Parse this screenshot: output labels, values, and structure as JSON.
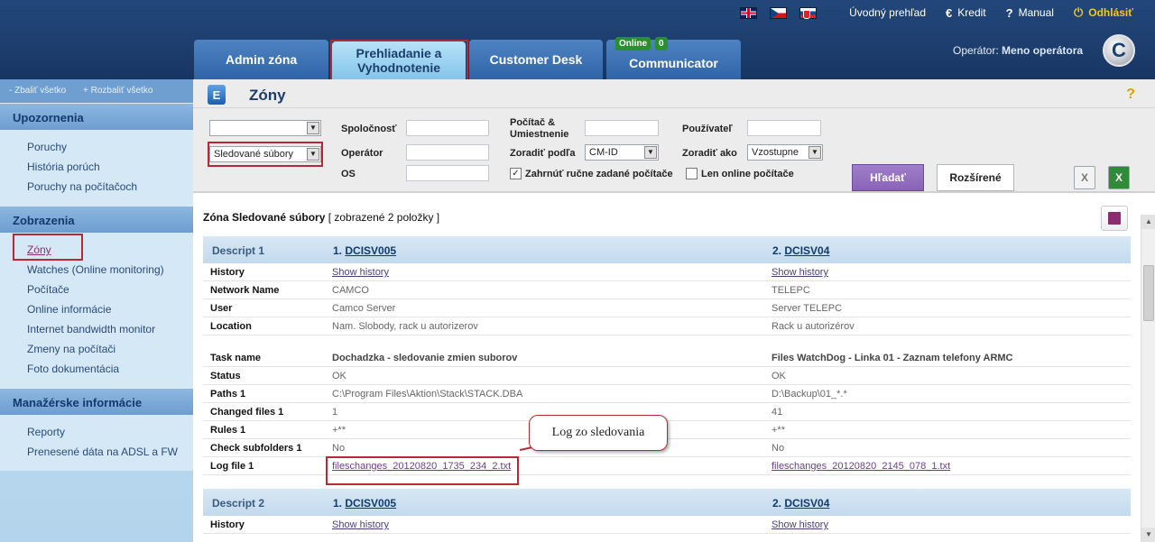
{
  "header": {
    "languages": [
      "en-flag-icon",
      "cz-flag-icon",
      "sk-flag-icon"
    ],
    "links": {
      "overview": "Úvodný prehľad",
      "credit": "Kredit",
      "manual": "Manual",
      "logout": "Odhlásiť"
    },
    "tabs": [
      {
        "label": "Admin zóna"
      },
      {
        "label": "Prehliadanie a Vyhodnotenie"
      },
      {
        "label": "Customer Desk"
      },
      {
        "label": "Communicator"
      }
    ],
    "communicator_status": "Online",
    "communicator_count": "0",
    "operator_label": "Operátor:",
    "operator_name": "Meno operátora"
  },
  "sidebar": {
    "collapse_all": "- Zbaliť všetko",
    "expand_all": "+ Rozbaliť všetko",
    "sections": [
      {
        "title": "Upozornenia",
        "items": [
          "Poruchy",
          "História porúch",
          "Poruchy na počítačoch"
        ]
      },
      {
        "title": "Zobrazenia",
        "items": [
          "Zóny",
          "Watches (Online monitoring)",
          "Počítače",
          "Online informácie",
          "Internet bandwidth monitor",
          "Zmeny na počítači",
          "Foto dokumentácia"
        ]
      },
      {
        "title": "Manažérske informácie",
        "items": [
          "Reporty",
          "Prenesené dáta na ADSL a FW"
        ]
      }
    ]
  },
  "main": {
    "title": "Zóny",
    "help": "?",
    "filter": {
      "zone_type_value": "Sledované súbory",
      "labels": {
        "company": "Spoločnosť",
        "operator": "Operátor",
        "os": "OS",
        "computer": "Počítač & Umiestnenie",
        "sort_by": "Zoradiť podľa",
        "user": "Používateľ",
        "sort_as": "Zoradiť ako"
      },
      "sort_by_value": "CM-ID",
      "sort_as_value": "Vzostupne",
      "include_manual": "Zahrnúť ručne zadané počítače",
      "only_online": "Len online počítače",
      "search_button": "Hľadať",
      "advanced_button": "Rozšírené"
    },
    "result_title": "Zóna Sledované súbory",
    "result_count": "[ zobrazené 2 položky ]",
    "group1": {
      "header": "Descript 1",
      "col1": "1.",
      "col1_link": "DCISV005",
      "col2": "2.",
      "col2_link": "DCISV04",
      "history": [
        "History",
        "Show history",
        "Show history"
      ],
      "network_name": [
        "Network Name",
        "CAMCO",
        "TELEPC"
      ],
      "user": [
        "User",
        "Camco Server",
        "Server TELEPC"
      ],
      "location": [
        "Location",
        "Nam. Slobody, rack u autorizerov",
        "Rack u autorizérov"
      ],
      "task_name": [
        "Task name",
        "Dochadzka - sledovanie zmien suborov",
        "Files WatchDog - Linka 01 - Zaznam telefony ARMC"
      ],
      "status": [
        "Status",
        "OK",
        "OK"
      ],
      "paths": [
        "Paths 1",
        "C:\\Program Files\\Aktion\\Stack\\STACK.DBA",
        "D:\\Backup\\01_*.*"
      ],
      "changed_files": [
        "Changed files 1",
        "1",
        "41"
      ],
      "rules": [
        "Rules 1",
        "+**",
        "+**"
      ],
      "check_subfolders": [
        "Check subfolders 1",
        "No",
        "No"
      ],
      "log_file": [
        "Log file 1",
        "fileschanges_20120820_1735_234_2.txt",
        "fileschanges_20120820_2145_078_1.txt"
      ]
    },
    "group2": {
      "header": "Descript 2",
      "col1": "1.",
      "col1_link": "DCISV005",
      "col2": "2.",
      "col2_link": "DCISV04",
      "history": [
        "History",
        "Show history",
        "Show history"
      ]
    },
    "callout": "Log zo sledovania"
  },
  "colors": {
    "header_bg": "#1d3e6e",
    "tab_bg": "#2f64a8",
    "active_tab_bg": "#9fd4f2",
    "sidebar_bg": "#c9e3f3",
    "search_btn": "#8a63b9",
    "highlight": "#b52a34",
    "logout": "#f3c623"
  }
}
